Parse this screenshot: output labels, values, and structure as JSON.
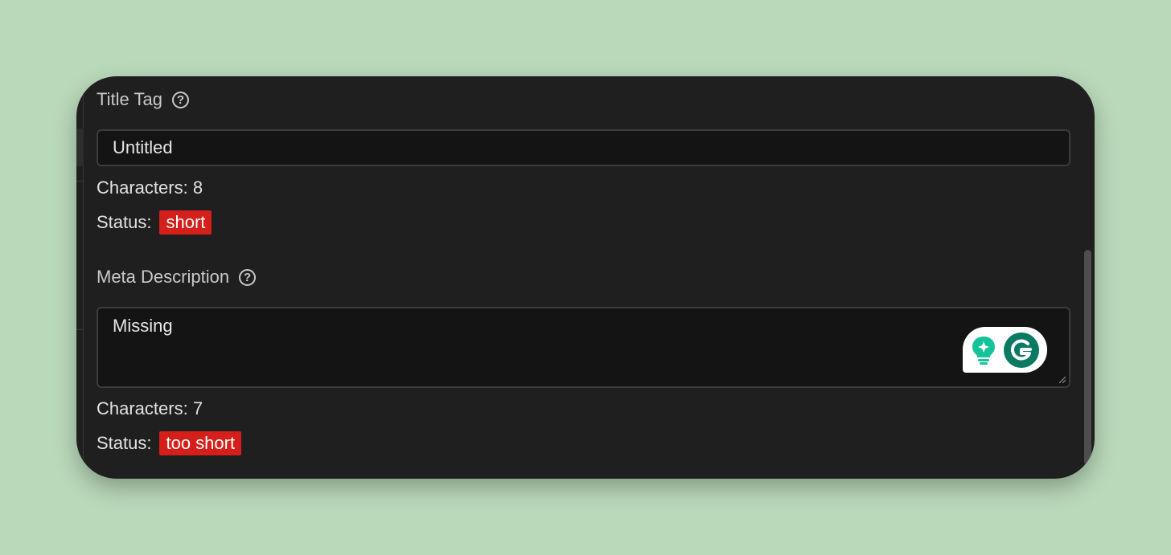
{
  "title_tag": {
    "label": "Title Tag",
    "help": "?",
    "value": "Untitled",
    "characters_text": "Characters: 8",
    "status_label": "Status:",
    "status_value": "short"
  },
  "meta_description": {
    "label": "Meta Description",
    "help": "?",
    "value": "Missing",
    "characters_text": "Characters: 7",
    "status_label": "Status:",
    "status_value": "too short"
  },
  "colors": {
    "background": "#b9d9bb",
    "panel": "#1f1f1f",
    "input": "#141414",
    "badge": "#d41f1a",
    "grammarly_teal": "#15c39a",
    "grammarly_dark": "#0b7a63"
  },
  "icons": {
    "help": "question-circle-icon",
    "assist": "lightbulb-sparkle-icon",
    "grammarly": "grammarly-g-icon",
    "resize": "resize-handle-icon"
  }
}
